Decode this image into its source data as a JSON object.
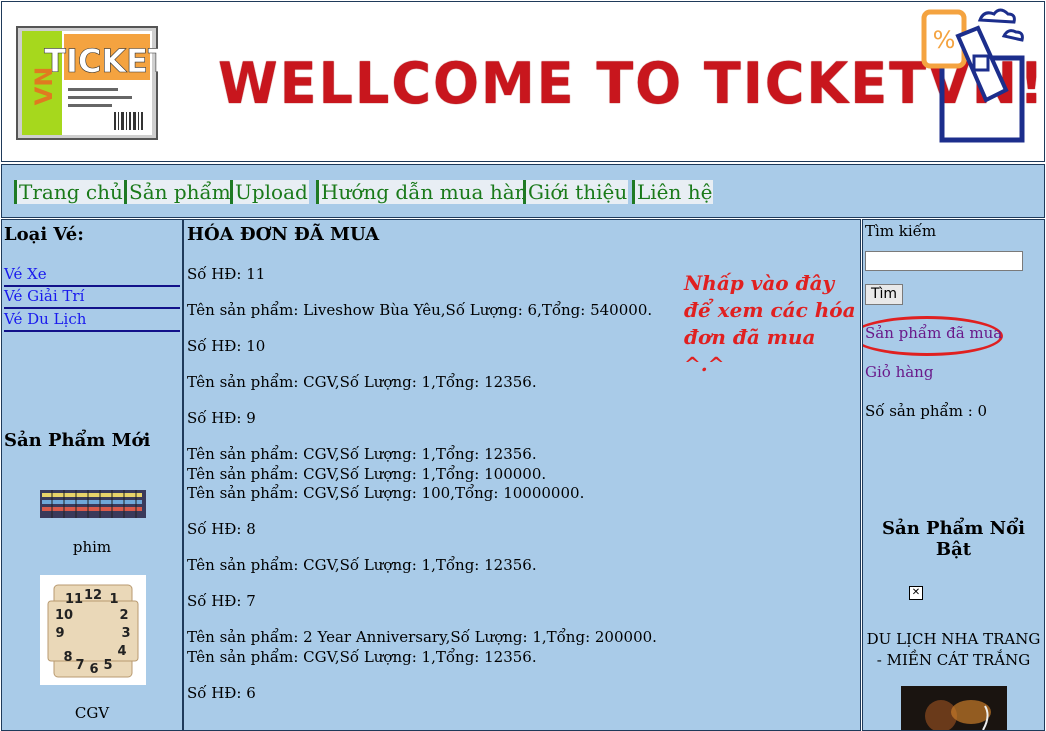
{
  "banner": {
    "logo_text": "TICKET",
    "logo_side_text": "VN",
    "welcome": "WELLCOME TO TICKETVN!"
  },
  "nav": [
    "Trang chủ",
    "Sản phẩm",
    "Upload",
    "Hướng dẫn mua hàng",
    "Giới thiệu",
    "Liên hệ"
  ],
  "left": {
    "category_title": "Loại Vé:",
    "categories": [
      "Vé Xe",
      "Vé Giải Trí",
      "Vé Du Lịch"
    ],
    "new_title": "Sản Phẩm Mới",
    "new_products": [
      "phim",
      "CGV"
    ]
  },
  "main": {
    "title": "HÓA ĐƠN ĐÃ MUA",
    "note": "Nhấp vào đây để xem các hóa đơn đã mua ^.^",
    "lines": [
      "Số HĐ: 11",
      "Tên sản phẩm: Liveshow Bùa Yêu,Số Lượng: 6,Tổng: 540000.",
      "Số HĐ: 10",
      "Tên sản phẩm: CGV,Số Lượng: 1,Tổng: 12356.",
      "Số HĐ: 9",
      "Tên sản phẩm: CGV,Số Lượng: 1,Tổng: 12356.",
      "Tên sản phẩm: CGV,Số Lượng: 1,Tổng: 100000.",
      "Tên sản phẩm: CGV,Số Lượng: 100,Tổng: 10000000.",
      "Số HĐ: 8",
      "Tên sản phẩm: CGV,Số Lượng: 1,Tổng: 12356.",
      "Số HĐ: 7",
      "Tên sản phẩm: 2 Year Anniversary,Số Lượng: 1,Tổng: 200000.",
      "Tên sản phẩm: CGV,Số Lượng: 1,Tổng: 12356.",
      "Số HĐ: 6"
    ]
  },
  "right": {
    "search_label": "Tìm kiếm",
    "search_value": "",
    "search_button": "Tìm",
    "purchased_link": "Sản phẩm đã mua",
    "cart_link": "Giỏ hàng",
    "product_count": "Số sản phẩm : 0",
    "featured_title": "Sản Phẩm Nổi Bật",
    "featured_caption": "DU LỊCH NHA TRANG - MIỀN CÁT TRẮNG"
  },
  "colors": {
    "panel_bg": "#a9cbe8",
    "nav_text": "#1a7a1a",
    "banner_red": "#c8161d",
    "link_blue": "#1a1aee",
    "visited_purple": "#6a1a8a",
    "note_red": "#e02020"
  }
}
